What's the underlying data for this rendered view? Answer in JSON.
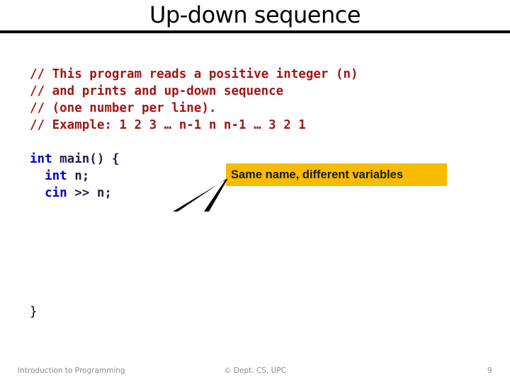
{
  "slide": {
    "title": "Up-down sequence",
    "comments": [
      "// This program reads a positive integer (n)",
      "// and prints and up-down sequence",
      "// (one number per line).",
      "// Example: 1 2 3 … n-1 n n-1 … 3 2 1"
    ],
    "code": {
      "line1_kw": "int",
      "line1_rest": " main() {",
      "line2_indent": "  ",
      "line2_kw": "int",
      "line2_rest": " n;",
      "line3_indent": "  ",
      "line3_kw": "cin",
      "line3_rest": " >> n;",
      "closing": "}"
    },
    "callout": {
      "text": "Same name, different variables",
      "color": "#f9bb00"
    },
    "colors": {
      "comment": "#a31515",
      "keyword": "#0000cc"
    }
  },
  "footer": {
    "left": "Introduction to Programming",
    "center": "© Dept. CS, UPC",
    "page_number": "9"
  }
}
